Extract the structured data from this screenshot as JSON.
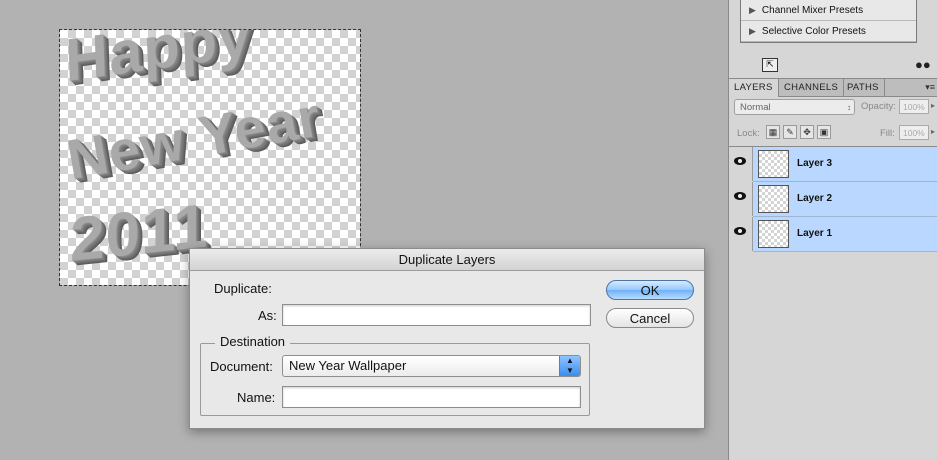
{
  "canvas": {
    "art_lines": [
      "Happy",
      "New Year",
      "2011"
    ]
  },
  "presets": {
    "items": [
      "Channel Mixer Presets",
      "Selective Color Presets"
    ]
  },
  "layers_panel": {
    "tabs": [
      "LAYERS",
      "CHANNELS",
      "PATHS"
    ],
    "blend_mode": "Normal",
    "opacity_label": "Opacity:",
    "opacity_value": "100%",
    "lock_label": "Lock:",
    "fill_label": "Fill:",
    "fill_value": "100%",
    "layers": [
      {
        "name": "Layer 3",
        "visible": true,
        "selected": true
      },
      {
        "name": "Layer 2",
        "visible": true,
        "selected": true
      },
      {
        "name": "Layer 1",
        "visible": true,
        "selected": true
      }
    ]
  },
  "dialog": {
    "title": "Duplicate Layers",
    "duplicate_label": "Duplicate:",
    "as_label": "As:",
    "as_value": "",
    "destination_legend": "Destination",
    "document_label": "Document:",
    "document_value": "New Year Wallpaper",
    "name_label": "Name:",
    "name_value": "",
    "ok_label": "OK",
    "cancel_label": "Cancel"
  },
  "colors": {
    "selection_blue": "#b9d7ff",
    "workspace_gray": "#b2b2b2",
    "default_button_blue": "#94c8fb"
  }
}
